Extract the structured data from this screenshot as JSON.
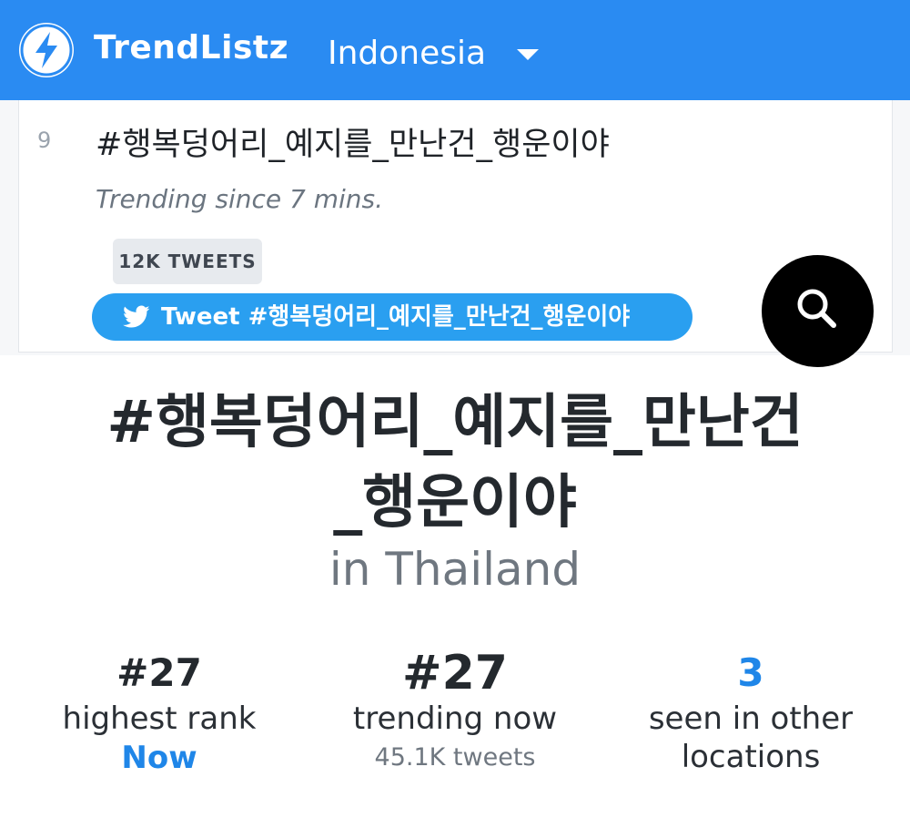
{
  "app": {
    "brand": "TrendListz",
    "country": "Indonesia"
  },
  "trend_item": {
    "rank": "9",
    "hashtag": "#행복덩어리_예지를_만난건_행운이야",
    "since": "Trending since 7 mins.",
    "tweets_badge": "12K TWEETS",
    "tweet_button_label": "Tweet #행복덩어리_예지를_만난건_행운이야"
  },
  "detail": {
    "title_line1": "#행복덩어리_예지를_만난건",
    "title_line2": "_행운이야",
    "location": "in Thailand"
  },
  "stats": [
    {
      "value": "#27",
      "label": "highest rank",
      "sub": "Now"
    },
    {
      "value": "#27",
      "label": "trending now",
      "sub": "45.1K tweets"
    },
    {
      "value": "3",
      "label_line1": "seen in other",
      "label_line2": "locations"
    }
  ],
  "icons": {
    "logo": "lightning-bolt-icon",
    "dropdown": "caret-down-icon",
    "twitter": "twitter-bird-icon",
    "search": "search-icon"
  },
  "colors": {
    "header": "#2a8bf2",
    "tweet_button": "#2a9ff0",
    "accent": "#1f86e8"
  }
}
